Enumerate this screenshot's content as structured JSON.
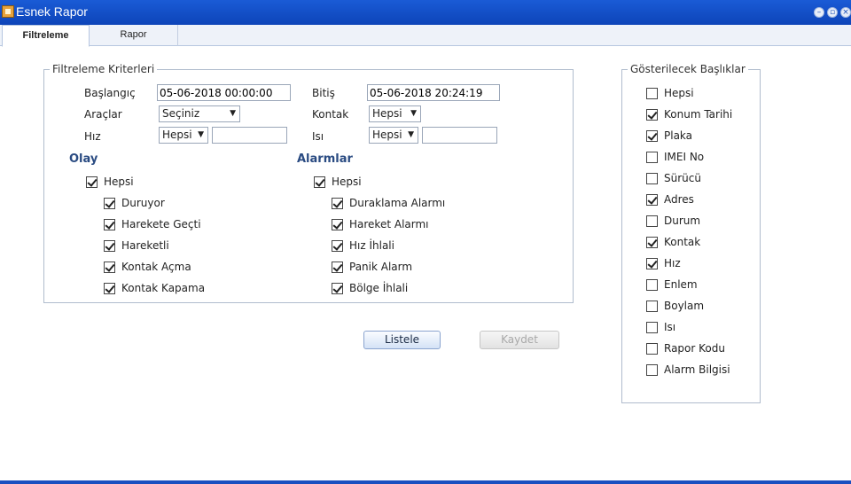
{
  "window": {
    "title": "Esnek Rapor"
  },
  "tabs": [
    {
      "label": "Filtreleme"
    },
    {
      "label": "Rapor"
    }
  ],
  "criteria": {
    "legend": "Filtreleme Kriterleri",
    "start_label": "Başlangıç",
    "start_value": "05-06-2018 00:00:00",
    "end_label": "Bitiş",
    "end_value": "05-06-2018 20:24:19",
    "vehicles_label": "Araçlar",
    "vehicles_value": "Seçiniz",
    "ignition_label": "Kontak",
    "ignition_value": "Hepsi",
    "speed_label": "Hız",
    "speed_value": "Hepsi",
    "speed_text": "",
    "temp_label": "Isı",
    "temp_value": "Hepsi",
    "temp_text": ""
  },
  "events": {
    "title": "Olay",
    "all": {
      "label": "Hepsi",
      "checked": true
    },
    "items": [
      {
        "label": "Duruyor",
        "checked": true
      },
      {
        "label": "Harekete Geçti",
        "checked": true
      },
      {
        "label": "Hareketli",
        "checked": true
      },
      {
        "label": "Kontak Açma",
        "checked": true
      },
      {
        "label": "Kontak Kapama",
        "checked": true
      }
    ]
  },
  "alarms": {
    "title": "Alarmlar",
    "all": {
      "label": "Hepsi",
      "checked": true
    },
    "items": [
      {
        "label": "Duraklama Alarmı",
        "checked": true
      },
      {
        "label": "Hareket Alarmı",
        "checked": true
      },
      {
        "label": "Hız İhlali",
        "checked": true
      },
      {
        "label": "Panik Alarm",
        "checked": true
      },
      {
        "label": "Bölge İhlali",
        "checked": true
      }
    ]
  },
  "actions": {
    "list_label": "Listele",
    "save_label": "Kaydet"
  },
  "columns": {
    "legend": "Gösterilecek Başlıklar",
    "items": [
      {
        "label": "Hepsi",
        "checked": false
      },
      {
        "label": "Konum Tarihi",
        "checked": true
      },
      {
        "label": "Plaka",
        "checked": true
      },
      {
        "label": "IMEI No",
        "checked": false
      },
      {
        "label": "Sürücü",
        "checked": false
      },
      {
        "label": "Adres",
        "checked": true
      },
      {
        "label": "Durum",
        "checked": false
      },
      {
        "label": "Kontak",
        "checked": true
      },
      {
        "label": "Hız",
        "checked": true
      },
      {
        "label": "Enlem",
        "checked": false
      },
      {
        "label": "Boylam",
        "checked": false
      },
      {
        "label": "Isı",
        "checked": false
      },
      {
        "label": "Rapor Kodu",
        "checked": false
      },
      {
        "label": "Alarm Bilgisi",
        "checked": false
      }
    ]
  },
  "icons": {
    "app": "report-icon",
    "minimize": "minimize-icon",
    "maximize": "maximize-icon",
    "close": "close-icon"
  }
}
